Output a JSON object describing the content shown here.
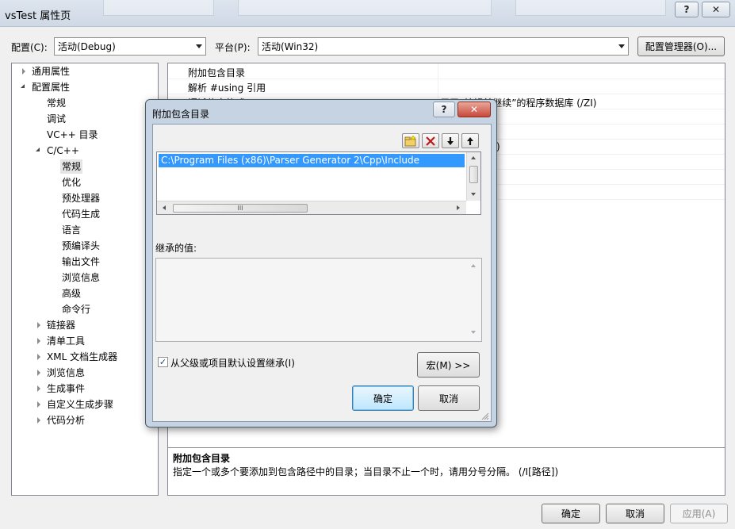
{
  "window": {
    "title": "vsTest 属性页",
    "help_btn": "?",
    "close_btn": "✕"
  },
  "config_bar": {
    "config_label": "配置(C):",
    "config_value": "活动(Debug)",
    "platform_label": "平台(P):",
    "platform_value": "活动(Win32)",
    "config_manager": "配置管理器(O)..."
  },
  "tree": {
    "items": [
      {
        "label": "通用属性"
      },
      {
        "label": "配置属性"
      },
      {
        "label": "常规"
      },
      {
        "label": "调试"
      },
      {
        "label": "VC++ 目录"
      },
      {
        "label": "C/C++"
      },
      {
        "label": "常规"
      },
      {
        "label": "优化"
      },
      {
        "label": "预处理器"
      },
      {
        "label": "代码生成"
      },
      {
        "label": "语言"
      },
      {
        "label": "预编译头"
      },
      {
        "label": "输出文件"
      },
      {
        "label": "浏览信息"
      },
      {
        "label": "高级"
      },
      {
        "label": "命令行"
      },
      {
        "label": "链接器"
      },
      {
        "label": "清单工具"
      },
      {
        "label": "XML 文档生成器"
      },
      {
        "label": "浏览信息"
      },
      {
        "label": "生成事件"
      },
      {
        "label": "自定义生成步骤"
      },
      {
        "label": "代码分析"
      }
    ]
  },
  "grid": {
    "rows": [
      {
        "name": "附加包含目录",
        "value": ""
      },
      {
        "name": "解析 #using 引用",
        "value": ""
      },
      {
        "name": "调试信息格式",
        "value": "用于“编辑并继续”的程序数据库 (/ZI)"
      }
    ],
    "partial_value": ")"
  },
  "description": {
    "title": "附加包含目录",
    "text": "指定一个或多个要添加到包含路径中的目录；当目录不止一个时，请用分号分隔。     (/I[路径])"
  },
  "bottom_buttons": {
    "ok": "确定",
    "cancel": "取消",
    "apply": "应用(A)"
  },
  "dialog": {
    "title": "附加包含目录",
    "help_btn": "?",
    "close_btn": "✕",
    "list_items": [
      "C:\\Program Files (x86)\\Parser Generator 2\\Cpp\\Include"
    ],
    "hscroll_grip": "III",
    "inherited_label": "继承的值:",
    "inherit_checkbox_label": "从父级或项目默认设置继承(I)",
    "inherit_checked": "✓",
    "macro_btn": "宏(M) >>",
    "ok": "确定",
    "cancel": "取消"
  },
  "colors": {
    "selection": "#3399ff",
    "dialog_frame": "#c6d3e2",
    "close_button": "#c9483a"
  }
}
